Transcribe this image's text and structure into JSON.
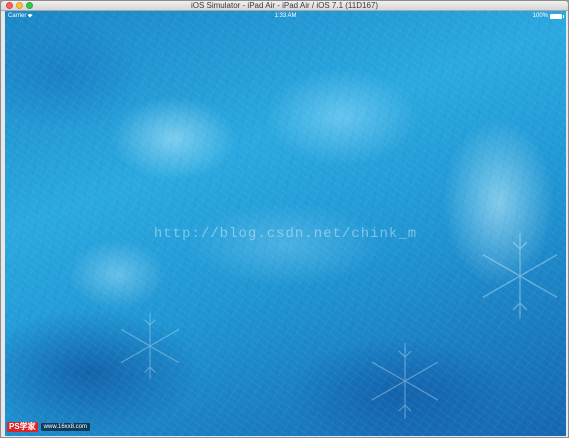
{
  "window": {
    "title": "iOS Simulator - iPad Air - iPad Air / iOS 7.1 (11D167)"
  },
  "statusbar": {
    "carrier": "Carrier",
    "wifi_icon": "wifi-icon",
    "time": "1:33 AM",
    "battery_percent": "100%",
    "battery_icon": "battery-icon"
  },
  "screen": {
    "background": "frozen ice crystal wallpaper",
    "watermark_text": "http://blog.csdn.net/chink_m",
    "logo_mark": "PS学家",
    "logo_url": "www.16xx8.com"
  },
  "colors": {
    "ice_blue": "#2aa9e0",
    "deep_blue": "#1566b0",
    "close": "#fc615d",
    "minimize": "#fdbc40",
    "maximize": "#34c84a"
  }
}
